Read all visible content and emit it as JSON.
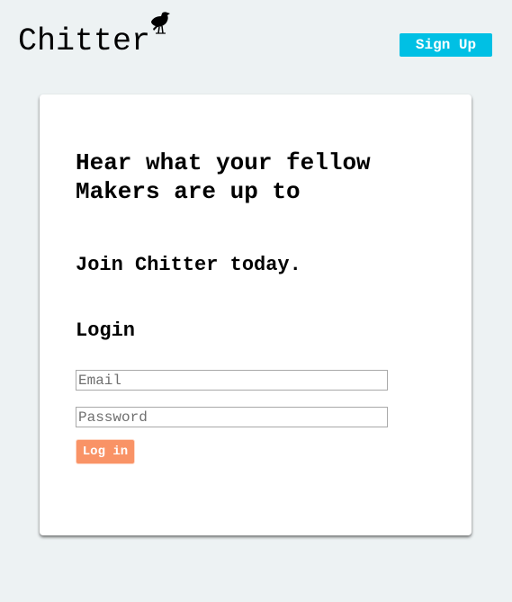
{
  "header": {
    "logo_text": "Chitter",
    "logo_icon": "crow-icon",
    "signup_label": "Sign Up"
  },
  "card": {
    "headline": "Hear what your fellow Makers are up to",
    "subhead": "Join Chitter today.",
    "login_title": "Login",
    "email_placeholder": "Email",
    "password_placeholder": "Password",
    "login_button": "Log in"
  },
  "colors": {
    "background": "#edf2f3",
    "signup_button": "#00c0e4",
    "login_button": "#f99366"
  }
}
